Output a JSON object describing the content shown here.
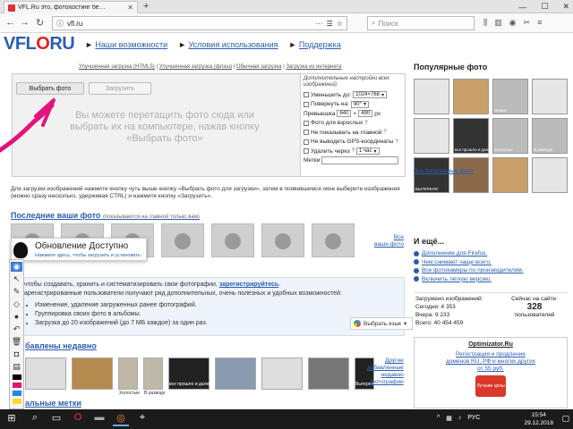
{
  "browser": {
    "tab_title": "VFL.Ru это, фотохостинг бе…",
    "url": "vfl.ru",
    "search_placeholder": "Поиск",
    "win_controls": [
      "—",
      "☐",
      "✕"
    ]
  },
  "site": {
    "logo_a": "VFL",
    "logo_o": "O",
    "logo_b": "RU",
    "nav": [
      "Наши возможности",
      "Условия использования",
      "Поддержка"
    ],
    "subtabs": [
      "Улучшенная загрузка (HTML5)",
      "Улучшенная загрузка (флэш)",
      "Обычная загрузка",
      "Загрузка из интернета"
    ]
  },
  "upload": {
    "select_label": "Выбрать фото",
    "upload_label": "Загрузить",
    "drop_text": "Вы можете перетащить фото сюда или выбрать их на компьютере, нажав кнопку «Выбрать фото»",
    "settings_head": "Дополнительные настройки всех изображений:",
    "reduce_label": "Уменьшить до:",
    "reduce_value": "1024×768",
    "rotate_label": "Повернуть на:",
    "rotate_value": "90°",
    "preview_label": "Превьюшка",
    "preview_w": "640",
    "preview_x": "×",
    "preview_h": "480",
    "preview_unit": "px",
    "adult_label": "Фото для взрослых",
    "nomain_label": "Не показывать на главной",
    "nogps_label": "Не выводить GPS-координаты",
    "delete_label": "Удалить через",
    "delete_value": "1 час",
    "tags_label": "Метки"
  },
  "instructions": "Для загрузки изображений нажмите кнопку чуть выше кнопку «Выбрать фото для загрузки», затем в появившемся окне выберите изображения (можно сразу несколько, удерживая CTRL) и нажмите кнопку «Загрузить».",
  "your_photos": {
    "title": "Последние ваши фото",
    "note": "(показываются на главной только вам)",
    "all_link_1": "Все",
    "all_link_2": "ваши фото"
  },
  "info": {
    "line1a": "чтобы создавать, хранить и систематизировать свои фотографии,",
    "line1b": "зарегистрируйтесь",
    "line2": "арегистрированные пользователи получают ряд дополнительных, очень полезных и удобных возможностей:",
    "bullets": [
      "Изменение, удаление загруженных ранее фотографий.",
      "Группировка своих фото в альбомы.",
      "Загрузка до 20 изображений (до 7 МБ каждое) за один раз."
    ],
    "translate_label": "Выбрать язык"
  },
  "recent": {
    "title": "бавлены недавно",
    "captions": [
      "",
      "",
      "Холостые",
      "В разводе",
      "все прошло и далеко",
      "",
      "",
      "",
      "Вытерел!!!"
    ],
    "other_1": "Другие",
    "other_2": "добавленные",
    "other_3": "недавно",
    "other_4": "фотографии"
  },
  "tags_section": "альные метки",
  "popular": {
    "title": "Популярные фото",
    "captions": [
      "",
      "",
      "Жених",
      "",
      "",
      "все прошло и далеко",
      "Холостые",
      "В разводе",
      "ВЫТЕРЕЛ!!!",
      "",
      "",
      ""
    ],
    "all_link": "Все популярные фото"
  },
  "more": {
    "title": "И ещё...",
    "items": [
      "Дополнение для Firefox.",
      "Чем снимают чаще всего.",
      "Все фотокамеры по производителям.",
      "Включить лёгкую версию."
    ]
  },
  "stats": {
    "loaded_label": "Загружено изображений:",
    "today": "Сегодня: 4 353",
    "yesterday": "Вчера: 9 233",
    "total": "Всего: 40 454 459",
    "online_label": "Сейчас на сайте:",
    "online_value": "328",
    "online_unit": "пользователей"
  },
  "ad": {
    "title": "Optimizator.Ru",
    "desc1": "Регистрация и продление",
    "desc2": "доменов RU, РФ и многих других",
    "desc3": "от 55 руб.",
    "badge": "Лучшие цены"
  },
  "notification": {
    "title": "Обновление Доступно",
    "subtitle": "Нажмите здесь, чтобы загрузить и установить"
  },
  "taskbar": {
    "time": "15:54",
    "date": "29.12.2018",
    "lang": "РУС"
  },
  "colors": {
    "link": "#2a5db0",
    "annotation": "#e0147c"
  }
}
